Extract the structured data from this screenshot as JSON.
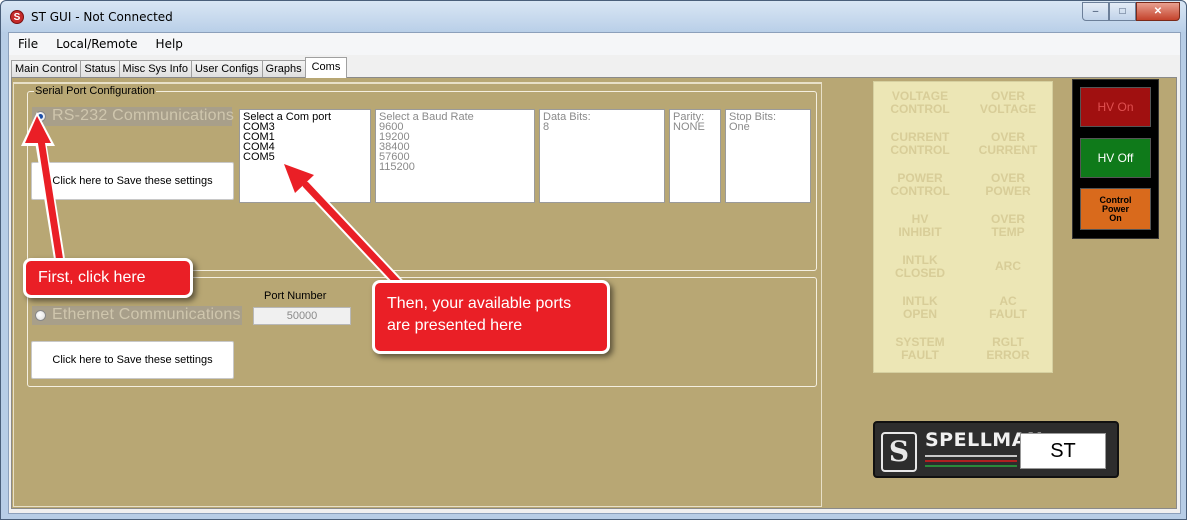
{
  "window": {
    "title": "ST GUI - Not Connected",
    "app_icon_glyph": "S",
    "minimize_glyph": "–",
    "maximize_glyph": "□",
    "close_glyph": "✕"
  },
  "menu": [
    "File",
    "Local/Remote",
    "Help"
  ],
  "tabs": [
    "Main Control",
    "Status",
    "Misc Sys Info",
    "User Configs",
    "Graphs",
    "Coms"
  ],
  "active_tab": "Coms",
  "serial": {
    "group_label": "Serial Port Configuration",
    "radio_label": "RS-232 Communications",
    "radio_checked": true,
    "save_button": "Click here to Save these settings",
    "com_list": {
      "header": "Select a Com port",
      "options": [
        "COM3",
        "COM1",
        "COM4",
        "COM5"
      ]
    },
    "baud_list": {
      "header": "Select a Baud Rate",
      "options": [
        "9600",
        "19200",
        "38400",
        "57600",
        "115200"
      ]
    },
    "data_bits": {
      "header": "Data Bits:",
      "value": "8"
    },
    "parity": {
      "header": "Parity:",
      "value": "NONE"
    },
    "stop_bits": {
      "header": "Stop Bits:",
      "value": "One"
    }
  },
  "ethernet": {
    "radio_label": "Ethernet Communications",
    "radio_checked": false,
    "port_label": "Port Number",
    "port_value": "50000",
    "save_button": "Click here to Save these settings"
  },
  "status_indicators": [
    [
      "VOLTAGE\nCONTROL",
      "OVER\nVOLTAGE"
    ],
    [
      "CURRENT\nCONTROL",
      "OVER\nCURRENT"
    ],
    [
      "POWER\nCONTROL",
      "OVER\nPOWER"
    ],
    [
      "HV\nINHIBIT",
      "OVER\nTEMP"
    ],
    [
      "INTLK\nCLOSED",
      "ARC"
    ],
    [
      "INTLK\nOPEN",
      "AC\nFAULT"
    ],
    [
      "SYSTEM\nFAULT",
      "RGLT\nERROR"
    ]
  ],
  "hv_buttons": {
    "hv_on": "HV On",
    "hv_off": "HV Off",
    "control_power": "Control Power On"
  },
  "logo": {
    "brand": "SPELLMAN",
    "model": "ST",
    "mark": "S"
  },
  "callouts": {
    "first": "First, click here",
    "then": "Then, your available ports are presented here"
  },
  "colors": {
    "panel_bg": "#b8a774",
    "status_bg": "#ece6b5",
    "hv_on": "#a01010",
    "hv_off": "#0f7a1a",
    "control_power": "#d96a1c",
    "callout": "#ea1f26"
  }
}
